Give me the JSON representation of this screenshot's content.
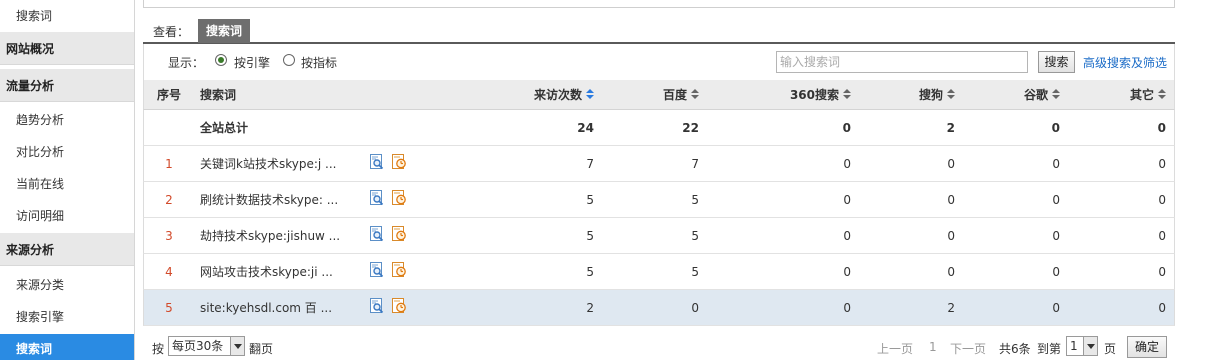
{
  "sidebar": {
    "items": [
      {
        "label": "搜索词",
        "type": "item"
      },
      {
        "label": "网站概况",
        "type": "group"
      },
      {
        "label": "流量分析",
        "type": "group"
      },
      {
        "label": "趋势分析",
        "type": "item"
      },
      {
        "label": "对比分析",
        "type": "item"
      },
      {
        "label": "当前在线",
        "type": "item"
      },
      {
        "label": "访问明细",
        "type": "item"
      },
      {
        "label": "来源分析",
        "type": "group"
      },
      {
        "label": "来源分类",
        "type": "item"
      },
      {
        "label": "搜索引擎",
        "type": "item"
      },
      {
        "label": "搜索词",
        "type": "active"
      }
    ]
  },
  "view": {
    "label": "查看：",
    "active_tab": "搜索词"
  },
  "filter": {
    "show_label": "显示：",
    "radio_engine": "按引擎",
    "radio_metric": "按指标",
    "search_placeholder": "输入搜索词",
    "search_button": "搜索",
    "advanced_link": "高级搜索及筛选"
  },
  "table": {
    "headers": {
      "idx": "序号",
      "keyword": "搜索词",
      "visits": "来访次数",
      "baidu": "百度",
      "s360": "360搜索",
      "sogou": "搜狗",
      "google": "谷歌",
      "other": "其它"
    },
    "total": {
      "label": "全站总计",
      "visits": "24",
      "baidu": "22",
      "s360": "0",
      "sogou": "2",
      "google": "0",
      "other": "0"
    },
    "rows": [
      {
        "idx": "1",
        "keyword": "关键词k站技术skype:j ...",
        "visits": "7",
        "baidu": "7",
        "s360": "0",
        "sogou": "0",
        "google": "0",
        "other": "0"
      },
      {
        "idx": "2",
        "keyword": "刷统计数据技术skype: ...",
        "visits": "5",
        "baidu": "5",
        "s360": "0",
        "sogou": "0",
        "google": "0",
        "other": "0"
      },
      {
        "idx": "3",
        "keyword": "劫持技术skype:jishuw ...",
        "visits": "5",
        "baidu": "5",
        "s360": "0",
        "sogou": "0",
        "google": "0",
        "other": "0"
      },
      {
        "idx": "4",
        "keyword": "网站攻击技术skype:ji ...",
        "visits": "5",
        "baidu": "5",
        "s360": "0",
        "sogou": "0",
        "google": "0",
        "other": "0"
      },
      {
        "idx": "5",
        "keyword": "site:kyehsdl.com 百 ...",
        "visits": "2",
        "baidu": "0",
        "s360": "0",
        "sogou": "2",
        "google": "0",
        "other": "0"
      }
    ]
  },
  "footer": {
    "per_label": "按",
    "per_page": "每页30条",
    "page_label": "翻页",
    "prev": "上一页",
    "current": "1",
    "next": "下一页",
    "total": "共6条",
    "goto": "到第",
    "page_select": "1",
    "page_unit": "页",
    "ok": "确定"
  },
  "colors": {
    "accent": "#2a8be3",
    "link": "#1a6bc7",
    "index_red": "#d24a2a",
    "selected_row": "#dfe8f1"
  }
}
